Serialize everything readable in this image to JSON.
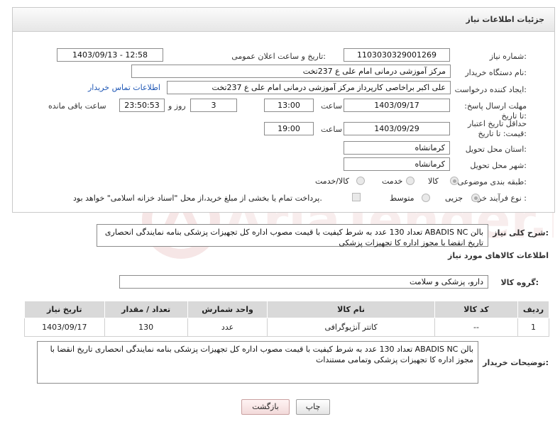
{
  "panel": {
    "title": "جزئیات اطلاعات نیاز"
  },
  "fields": {
    "need_number_label": "شماره نیاز:",
    "need_number": "1103030329001269",
    "announce_label": "تاریخ و ساعت اعلان عمومی:",
    "announce_value": "1403/09/13 - 12:58",
    "buyer_org_label": "نام دستگاه خریدار:",
    "buyer_org": "مرکز آموزشی درمانی امام علی ع 237تخت",
    "requester_label": "ایجاد کننده درخواست:",
    "requester": "علی اکبر براخاصی کارپرداز  مرکز آموزشی درمانی امام علی ع 237تخت",
    "buyer_contact_link": "اطلاعات تماس خریدار",
    "reply_deadline_label": "مهلت ارسال پاسخ: تا تاریخ:",
    "reply_date": "1403/09/17",
    "time_label": "ساعت",
    "reply_time": "13:00",
    "days_value": "3",
    "days_label": "روز و",
    "remaining_time": "23:50:53",
    "remaining_label": "ساعت باقی مانده",
    "price_validity_label": "حداقل تاریخ اعتبار قیمت: تا تاریخ:",
    "price_date": "1403/09/29",
    "price_time_label": "ساعت",
    "price_time": "19:00",
    "province_label": "استان محل تحویل:",
    "province": "کرمانشاه",
    "city_label": "شهر محل تحویل:",
    "city": "کرمانشاه",
    "category_label": "طبقه بندی موضوعی:",
    "category_options": [
      "کالا",
      "خدمت",
      "کالا/خدمت"
    ],
    "process_label": "نوع فرآیند خرید :",
    "process_options": [
      "جزیی",
      "متوسط"
    ],
    "payment_note": "پرداخت تمام یا بخشی از مبلغ خرید،از محل \"اسناد خزانه اسلامی\" خواهد بود."
  },
  "description": {
    "label": "شرح کلی نیاز:",
    "text": "بالن ABADIS NC تعداد 130 عدد به شرط کیفیت با قیمت مصوب اداره کل تجهیزات پزشکی بنامه نمایندگی انحصاری تاریخ انقضا با مجوز اداره کا تجهیزات پزشکی"
  },
  "goods": {
    "section_title": "اطلاعات کالاهای مورد نیاز",
    "group_label": "گروه کالا:",
    "group_value": "دارو، پزشکی و سلامت",
    "columns": [
      "ردیف",
      "کد کالا",
      "نام کالا",
      "واحد شمارش",
      "تعداد / مقدار",
      "تاریخ نیاز"
    ],
    "rows": [
      [
        "1",
        "--",
        "کاتتر آنژیوگرافی",
        "عدد",
        "130",
        "1403/09/17"
      ]
    ]
  },
  "buyer_notes": {
    "label": "توضیحات خریدار:",
    "text": "بالن ABADIS NC تعداد 130 عدد به شرط کیفیت با قیمت مصوب اداره کل تجهیزات پزشکی بنامه نمایندگی انحصاری تاریخ انقضا با مجوز اداره کا تجهیزات پزشکی وتمامی مستندات"
  },
  "buttons": {
    "print": "چاپ",
    "back": "بازگشت"
  },
  "watermark": {
    "brand": "AriaTender.neT"
  },
  "colors": {
    "link": "#1f57b5",
    "header_bg": "#e6e6e6",
    "table_header": "#d9d9d9",
    "watermark": "#f1dede"
  }
}
